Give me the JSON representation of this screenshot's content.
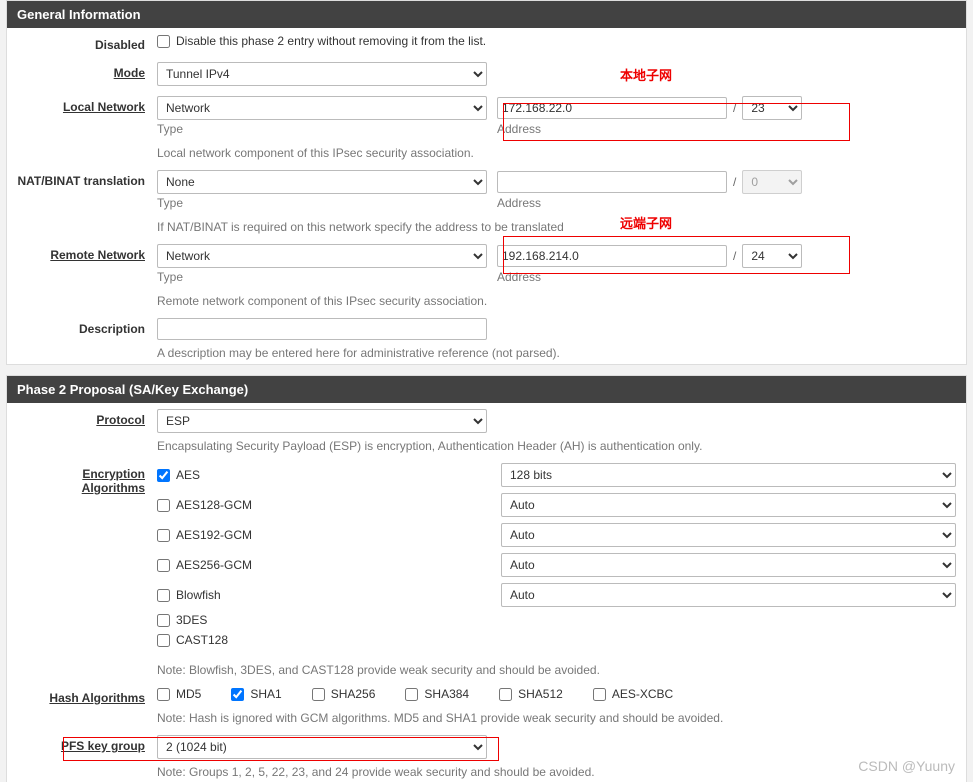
{
  "panels": {
    "general": {
      "title": "General Information"
    },
    "phase2": {
      "title": "Phase 2 Proposal (SA/Key Exchange)"
    }
  },
  "disabled": {
    "label": "Disabled",
    "text": "Disable this phase 2 entry without removing it from the list."
  },
  "mode": {
    "label": "Mode",
    "value": "Tunnel IPv4"
  },
  "local_network": {
    "label": "Local Network",
    "type_value": "Network",
    "type_hint": "Type",
    "address": "172.168.22.0",
    "prefix": "23",
    "addr_hint": "Address",
    "desc": "Local network component of this IPsec security association."
  },
  "nat": {
    "label": "NAT/BINAT translation",
    "type_value": "None",
    "type_hint": "Type",
    "address": "",
    "prefix": "0",
    "addr_hint": "Address",
    "desc": "If NAT/BINAT is required on this network specify the address to be translated"
  },
  "remote_network": {
    "label": "Remote Network",
    "type_value": "Network",
    "type_hint": "Type",
    "address": "192.168.214.0",
    "prefix": "24",
    "addr_hint": "Address",
    "desc": "Remote network component of this IPsec security association."
  },
  "description": {
    "label": "Description",
    "value": "",
    "desc": "A description may be entered here for administrative reference (not parsed)."
  },
  "protocol": {
    "label": "Protocol",
    "value": "ESP",
    "desc": "Encapsulating Security Payload (ESP) is encryption, Authentication Header (AH) is authentication only."
  },
  "encryption": {
    "label": "Encryption Algorithms",
    "items": [
      {
        "name": "AES",
        "checked": true,
        "bits": "128 bits"
      },
      {
        "name": "AES128-GCM",
        "checked": false,
        "bits": "Auto"
      },
      {
        "name": "AES192-GCM",
        "checked": false,
        "bits": "Auto"
      },
      {
        "name": "AES256-GCM",
        "checked": false,
        "bits": "Auto"
      },
      {
        "name": "Blowfish",
        "checked": false,
        "bits": "Auto"
      },
      {
        "name": "3DES",
        "checked": false,
        "bits": ""
      },
      {
        "name": "CAST128",
        "checked": false,
        "bits": ""
      }
    ],
    "note": "Note: Blowfish, 3DES, and CAST128 provide weak security and should be avoided."
  },
  "hash": {
    "label": "Hash Algorithms",
    "items": [
      {
        "name": "MD5",
        "checked": false
      },
      {
        "name": "SHA1",
        "checked": true
      },
      {
        "name": "SHA256",
        "checked": false
      },
      {
        "name": "SHA384",
        "checked": false
      },
      {
        "name": "SHA512",
        "checked": false
      },
      {
        "name": "AES-XCBC",
        "checked": false
      }
    ],
    "note": "Note: Hash is ignored with GCM algorithms. MD5 and SHA1 provide weak security and should be avoided."
  },
  "pfs": {
    "label": "PFS key group",
    "value": "2 (1024 bit)",
    "note": "Note: Groups 1, 2, 5, 22, 23, and 24 provide weak security and should be avoided."
  },
  "annotations": {
    "local": "本地子网",
    "remote": "远端子网"
  },
  "watermark": "CSDN @Yuuny"
}
